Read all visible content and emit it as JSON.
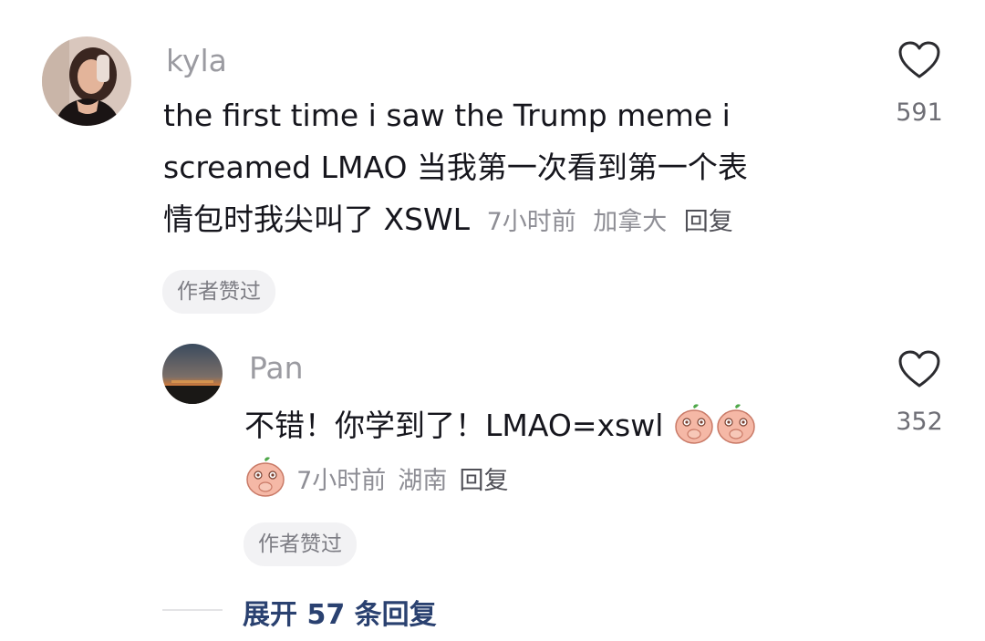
{
  "comment": {
    "username": "kyla",
    "text_line1": "the first time i saw the Trump meme i",
    "text_line2": "screamed LMAO 当我第一次看到第一个表",
    "text_line3": "情包时我尖叫了 XSWL",
    "time": "7小时前",
    "location": "加拿大",
    "reply_label": "回复",
    "author_liked": "作者赞过",
    "like_count": "591"
  },
  "reply": {
    "username": "Pan",
    "text": "不错！你学到了！LMAO=xswl",
    "time": "7小时前",
    "location": "湖南",
    "reply_label": "回复",
    "author_liked": "作者赞过",
    "like_count": "352"
  },
  "expand": {
    "label": "展开 57 条回复"
  },
  "icons": {
    "like": "heart-outline-icon",
    "emoji": "peach-covering-mouth-emoji"
  }
}
